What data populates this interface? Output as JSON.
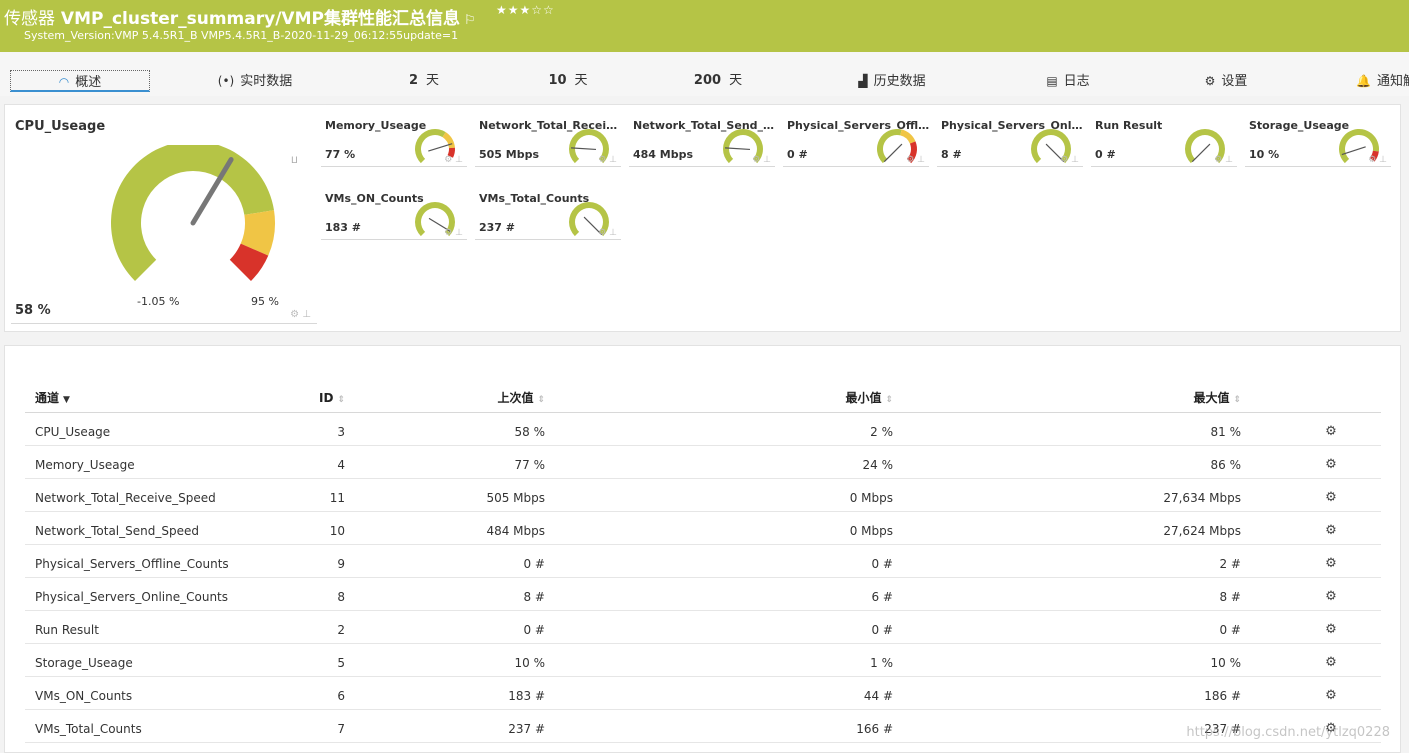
{
  "header": {
    "prefix": "传感器",
    "title": "VMP_cluster_summary/VMP集群性能汇总信息",
    "flag_icon": "flag-icon",
    "stars": "★★★☆☆",
    "subtitle": "System_Version:VMP 5.4.5R1_B VMP5.4.5R1_B-2020-11-29_06:12:55update=1",
    "color": "#b5c446"
  },
  "tabs": [
    {
      "label": "概述",
      "icon": "refresh-icon"
    },
    {
      "label": "实时数据",
      "icon": "broadcast-icon"
    },
    {
      "num": "2",
      "label": "天"
    },
    {
      "num": "10",
      "label": "天"
    },
    {
      "num": "200",
      "label": "天"
    },
    {
      "label": "历史数据",
      "icon": "area-chart-icon"
    },
    {
      "label": "日志",
      "icon": "list-icon"
    },
    {
      "label": "设置",
      "icon": "gear-icon"
    },
    {
      "label": "通知触",
      "icon": "bell-icon"
    }
  ],
  "big_gauge": {
    "name": "CPU_Useage",
    "value": "58 %",
    "min": "-1.05 %",
    "max": "95 %",
    "percent": 58
  },
  "gauges": [
    {
      "name": "Memory_Useage",
      "value": "77 %",
      "percent": 77,
      "style": "yellow-red"
    },
    {
      "name": "Network_Total_Receive_Speed",
      "value": "505 Mbps",
      "percent": 18,
      "style": "green"
    },
    {
      "name": "Network_Total_Send_Speed",
      "value": "484 Mbps",
      "percent": 18,
      "style": "green"
    },
    {
      "name": "Physical_Servers_Offline_Counts",
      "value": "0 #",
      "percent": 0,
      "style": "alarm"
    },
    {
      "name": "Physical_Servers_Online_Counts",
      "value": "8 #",
      "percent": 100,
      "style": "green"
    },
    {
      "name": "Run Result",
      "value": "0 #",
      "percent": 0,
      "style": "green"
    },
    {
      "name": "Storage_Useage",
      "value": "10 %",
      "percent": 10,
      "style": "green-red"
    },
    {
      "name": "VMs_ON_Counts",
      "value": "183 #",
      "percent": 95,
      "style": "green"
    },
    {
      "name": "VMs_Total_Counts",
      "value": "237 #",
      "percent": 100,
      "style": "green"
    }
  ],
  "table": {
    "headers": {
      "name": "通道",
      "id": "ID",
      "last": "上次值",
      "min": "最小值",
      "max": "最大值"
    },
    "rows": [
      {
        "name": "CPU_Useage",
        "id": "3",
        "last": "58 %",
        "min": "2 %",
        "max": "81 %"
      },
      {
        "name": "Memory_Useage",
        "id": "4",
        "last": "77 %",
        "min": "24 %",
        "max": "86 %"
      },
      {
        "name": "Network_Total_Receive_Speed",
        "id": "11",
        "last": "505 Mbps",
        "min": "0 Mbps",
        "max": "27,634 Mbps"
      },
      {
        "name": "Network_Total_Send_Speed",
        "id": "10",
        "last": "484 Mbps",
        "min": "0 Mbps",
        "max": "27,624 Mbps"
      },
      {
        "name": "Physical_Servers_Offline_Counts",
        "id": "9",
        "last": "0 #",
        "min": "0 #",
        "max": "2 #"
      },
      {
        "name": "Physical_Servers_Online_Counts",
        "id": "8",
        "last": "8 #",
        "min": "6 #",
        "max": "8 #"
      },
      {
        "name": "Run Result",
        "id": "2",
        "last": "0 #",
        "min": "0 #",
        "max": "0 #"
      },
      {
        "name": "Storage_Useage",
        "id": "5",
        "last": "10 %",
        "min": "1 %",
        "max": "10 %"
      },
      {
        "name": "VMs_ON_Counts",
        "id": "6",
        "last": "183 #",
        "min": "44 #",
        "max": "186 #"
      },
      {
        "name": "VMs_Total_Counts",
        "id": "7",
        "last": "237 #",
        "min": "166 #",
        "max": "237 #"
      }
    ]
  },
  "watermark": "https://blog.csdn.net/ytlzq0228"
}
